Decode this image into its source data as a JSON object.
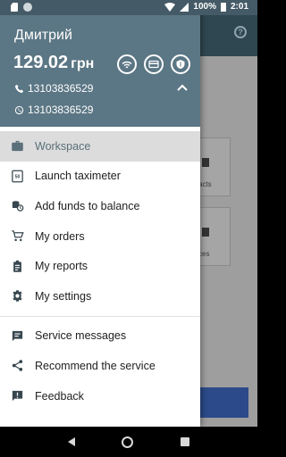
{
  "status_bar": {
    "battery": "100%",
    "time": "2:01"
  },
  "drawer": {
    "user_name": "Дмитрий",
    "balance_amount": "129.02",
    "balance_currency": "грн",
    "phone": "13103836529",
    "whatsapp": "13103836529",
    "header_icons": [
      "wifi-icon",
      "card-icon",
      "shield-icon"
    ]
  },
  "menu": {
    "primary": [
      {
        "label": "Workspace",
        "icon": "briefcase-icon",
        "active": true
      },
      {
        "label": "Launch taximeter",
        "icon": "taximeter-icon",
        "active": false
      },
      {
        "label": "Add funds to balance",
        "icon": "coins-icon",
        "active": false
      },
      {
        "label": "My orders",
        "icon": "cart-icon",
        "active": false
      },
      {
        "label": "My reports",
        "icon": "clipboard-icon",
        "active": false
      },
      {
        "label": "My settings",
        "icon": "gear-icon",
        "active": false
      }
    ],
    "secondary": [
      {
        "label": "Service messages",
        "icon": "message-icon"
      },
      {
        "label": "Recommend the service",
        "icon": "share-icon"
      },
      {
        "label": "Feedback",
        "icon": "feedback-icon"
      }
    ]
  },
  "background": {
    "card1_label": "acts",
    "card2_label": "ces"
  },
  "colors": {
    "header": "#5b7684",
    "status_bar": "#445a66",
    "active_item_bg": "#dcdcdc",
    "background_button": "#2c4a8a"
  }
}
